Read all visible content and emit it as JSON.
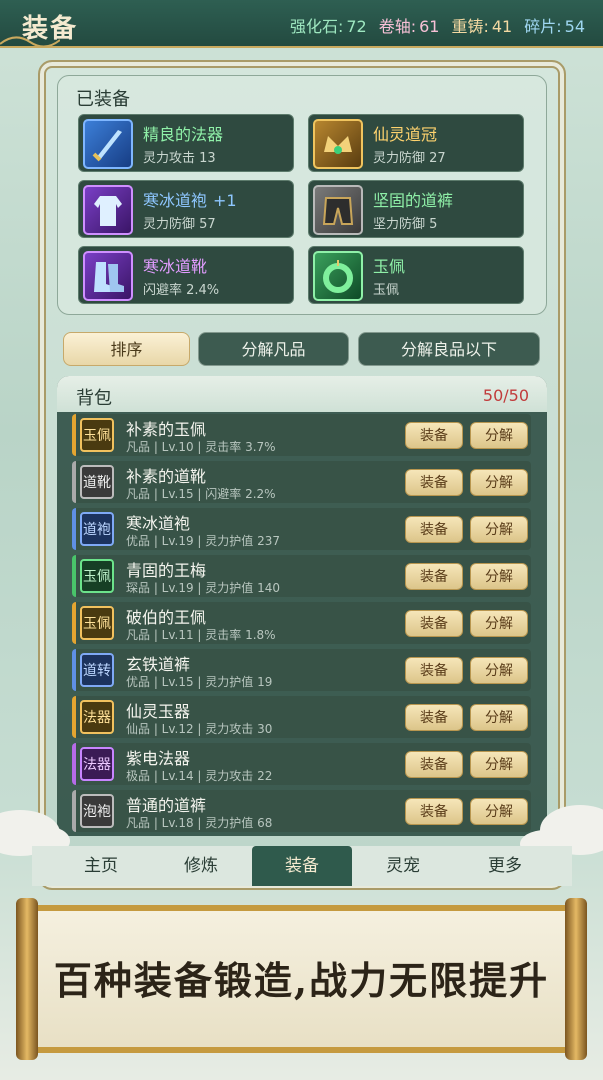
{
  "header": {
    "title": "装备"
  },
  "currencies": [
    {
      "label": "强化石:",
      "value": "72"
    },
    {
      "label": "卷轴:",
      "value": "61"
    },
    {
      "label": "重铸:",
      "value": "41"
    },
    {
      "label": "碎片:",
      "value": "54"
    }
  ],
  "equipped": {
    "title": "已装备",
    "items": [
      {
        "name": "精良的法器",
        "stat": "灵力攻击 13",
        "icon": "sword-icon",
        "plus": ""
      },
      {
        "name": "仙灵道冠",
        "stat": "灵力防御 27",
        "icon": "crown-icon",
        "plus": ""
      },
      {
        "name": "寒冰道袍",
        "stat": "灵力防御 57",
        "icon": "robe-icon",
        "plus": "+1"
      },
      {
        "name": "坚固的道裤",
        "stat": "坚力防御 5",
        "icon": "pants-icon",
        "plus": ""
      },
      {
        "name": "寒冰道靴",
        "stat": "闪避率 2.4%",
        "icon": "boots-icon",
        "plus": ""
      },
      {
        "name": "玉佩",
        "stat": "玉佩",
        "icon": "jade-pendant-icon",
        "plus": ""
      }
    ]
  },
  "actions": {
    "sort": "排序",
    "decompose_common": "分解凡品",
    "decompose_below_good": "分解良品以下"
  },
  "bag": {
    "title": "背包",
    "count": "50/50",
    "equip_label": "装备",
    "decompose_label": "分解",
    "items": [
      {
        "icon_text": "玉佩",
        "name": "补素的玉佩",
        "sub": "凡品 | Lv.10 | 灵击率 3.7%"
      },
      {
        "icon_text": "道靴",
        "name": "补素的道靴",
        "sub": "凡品 | Lv.15 | 闪避率 2.2%"
      },
      {
        "icon_text": "道袍",
        "name": "寒冰道袍",
        "sub": "优品 | Lv.19 | 灵力护值 237"
      },
      {
        "icon_text": "玉佩",
        "name": "青固的王梅",
        "sub": "琛品 | Lv.19 | 灵力护值 140"
      },
      {
        "icon_text": "玉佩",
        "name": "破伯的王佩",
        "sub": "凡品 | Lv.11 | 灵击率 1.8%"
      },
      {
        "icon_text": "道转",
        "name": "玄铁道裤",
        "sub": "优品 | Lv.15 | 灵力护值 19"
      },
      {
        "icon_text": "法器",
        "name": "仙灵玉器",
        "sub": "仙品 | Lv.12 | 灵力攻击 30"
      },
      {
        "icon_text": "法器",
        "name": "紫电法器",
        "sub": "极品 | Lv.14 | 灵力攻击 22"
      },
      {
        "icon_text": "泡袍",
        "name": "普通的道裤",
        "sub": "凡品 | Lv.18 | 灵力护值 68"
      }
    ]
  },
  "nav": {
    "items": [
      "主页",
      "修炼",
      "装备",
      "灵宠",
      "更多"
    ],
    "active": "装备"
  },
  "banner": {
    "slogan": "百种装备锻造,战力无限提升"
  }
}
